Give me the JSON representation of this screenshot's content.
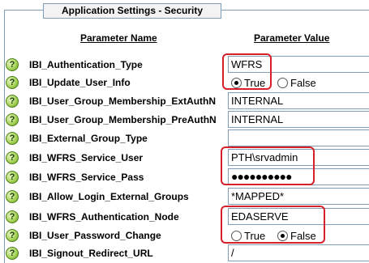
{
  "panel": {
    "title": "Application Settings - Security"
  },
  "columns": {
    "name": "Parameter Name",
    "value": "Parameter Value"
  },
  "help_glyph": "?",
  "params": [
    {
      "name": "IBI_Authentication_Type",
      "kind": "text",
      "value": "WFRS"
    },
    {
      "name": "IBI_Update_User_Info",
      "kind": "radio",
      "options": [
        "True",
        "False"
      ],
      "selected": "True"
    },
    {
      "name": "IBI_User_Group_Membership_ExtAuthN",
      "kind": "text",
      "value": "INTERNAL"
    },
    {
      "name": "IBI_User_Group_Membership_PreAuthN",
      "kind": "text",
      "value": "INTERNAL"
    },
    {
      "name": "IBI_External_Group_Type",
      "kind": "text",
      "value": ""
    },
    {
      "name": "IBI_WFRS_Service_User",
      "kind": "text",
      "value": "PTH\\srvadmin"
    },
    {
      "name": "IBI_WFRS_Service_Pass",
      "kind": "password",
      "value": "●●●●●●●●●●"
    },
    {
      "name": "IBI_Allow_Login_External_Groups",
      "kind": "text",
      "value": "*MAPPED*"
    },
    {
      "name": "IBI_WFRS_Authentication_Node",
      "kind": "text",
      "value": "EDASERVE"
    },
    {
      "name": "IBI_User_Password_Change",
      "kind": "radio",
      "options": [
        "True",
        "False"
      ],
      "selected": "False"
    },
    {
      "name": "IBI_Signout_Redirect_URL",
      "kind": "text",
      "value": "/"
    }
  ],
  "colors": {
    "highlight": "#d6202a",
    "border": "#7f9db9",
    "help_icon": "#8cc63f"
  }
}
